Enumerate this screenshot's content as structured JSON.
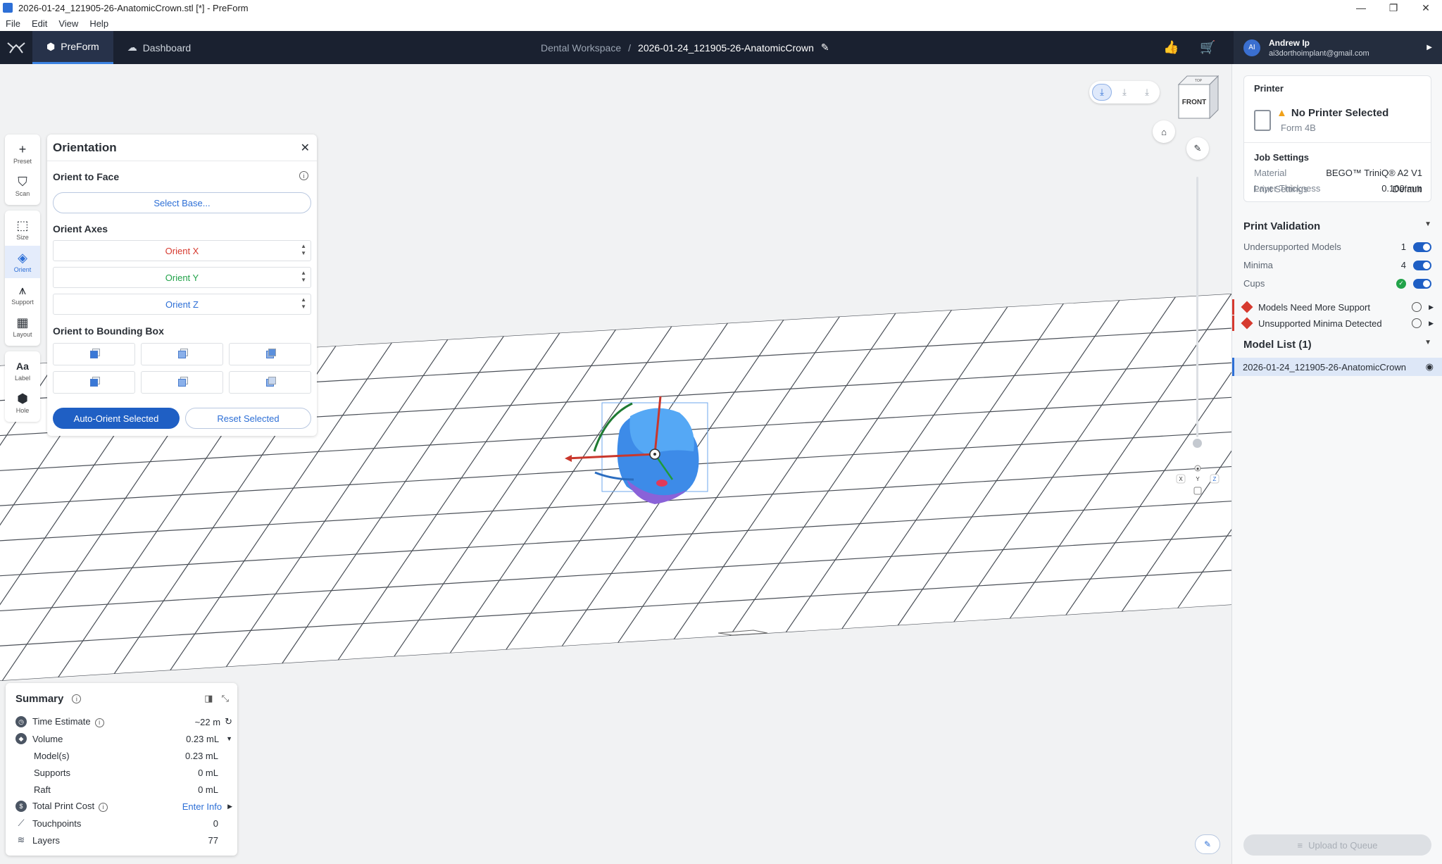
{
  "window": {
    "title": "2026-01-24_121905-26-AnatomicCrown.stl [*] - PreForm",
    "controls": [
      "—",
      "❐",
      "✕"
    ]
  },
  "menu": [
    "File",
    "Edit",
    "View",
    "Help"
  ],
  "nav": {
    "tabs": [
      {
        "label": "PreForm",
        "active": true
      },
      {
        "label": "Dashboard",
        "active": false
      }
    ],
    "workspace": "Dental Workspace",
    "separator": "/",
    "filename": "2026-01-24_121905-26-AnatomicCrown",
    "user": {
      "initials": "AI",
      "name": "Andrew Ip",
      "email": "ai3dorthoimplant@gmail.com"
    }
  },
  "tools": [
    {
      "label": "Preset",
      "icon": "plus-icon",
      "glyph": "+"
    },
    {
      "label": "Scan",
      "icon": "tooth-icon",
      "glyph": "⛉"
    },
    {
      "label": "Size",
      "icon": "size-icon",
      "glyph": "⬚"
    },
    {
      "label": "Orient",
      "icon": "orient-icon",
      "glyph": "◈",
      "active": true
    },
    {
      "label": "Support",
      "icon": "support-icon",
      "glyph": "⩚"
    },
    {
      "label": "Layout",
      "icon": "layout-icon",
      "glyph": "▦"
    },
    {
      "label": "Label",
      "icon": "label-icon",
      "glyph": "Aa"
    },
    {
      "label": "Hole",
      "icon": "hole-icon",
      "glyph": "⬢"
    }
  ],
  "orientation": {
    "title": "Orientation",
    "close": "✕",
    "face_title": "Orient to Face",
    "select_base": "Select Base...",
    "axes_title": "Orient Axes",
    "axes": [
      {
        "label": "Orient X",
        "color": "#d63a2f"
      },
      {
        "label": "Orient Y",
        "color": "#22a34a"
      },
      {
        "label": "Orient Z",
        "color": "#2d6fd6"
      }
    ],
    "bbox_title": "Orient to Bounding Box",
    "auto_orient": "Auto-Orient Selected",
    "reset": "Reset Selected"
  },
  "viewcube": {
    "label": "FRONT",
    "top": "TOP"
  },
  "summary": {
    "title": "Summary",
    "rows": [
      {
        "label": "Time Estimate",
        "value": "~22 m",
        "icon": "clock-icon"
      },
      {
        "label": "Volume",
        "value": "0.23 mL",
        "icon": "volume-icon"
      },
      {
        "label": "Model(s)",
        "value": "0.23 mL",
        "sub": true
      },
      {
        "label": "Supports",
        "value": "0 mL",
        "sub": true
      },
      {
        "label": "Raft",
        "value": "0 mL",
        "sub": true
      },
      {
        "label": "Total Print Cost",
        "value": "Enter Info",
        "icon": "dollar-icon"
      },
      {
        "label": "Touchpoints",
        "value": "0",
        "icon": "touchpoint-icon"
      },
      {
        "label": "Layers",
        "value": "77",
        "icon": "layers-icon"
      }
    ]
  },
  "printer": {
    "title": "Printer",
    "name": "No Printer Selected",
    "model": "Form 4B",
    "job_settings_title": "Job Settings",
    "settings": [
      {
        "key": "Material",
        "value": "BEGO™ TriniQ® A2 V1"
      },
      {
        "key": "Layer Thickness",
        "value": "0.100 mm"
      },
      {
        "key": "Print Settings",
        "value": "Default"
      }
    ]
  },
  "validation": {
    "title": "Print Validation",
    "rows": [
      {
        "label": "Undersupported Models",
        "count": "1"
      },
      {
        "label": "Minima",
        "count": "4"
      },
      {
        "label": "Cups",
        "count": ""
      }
    ],
    "issues": [
      "Models Need More Support",
      "Unsupported Minima Detected"
    ]
  },
  "model_list": {
    "title": "Model List (1)",
    "items": [
      "2026-01-24_121905-26-AnatomicCrown"
    ]
  },
  "upload": "Upload to Queue",
  "colors": {
    "accent": "#1f5fc4",
    "nav_bg": "#1a2130",
    "error": "#d63a2f",
    "warn": "#f0a11a"
  }
}
